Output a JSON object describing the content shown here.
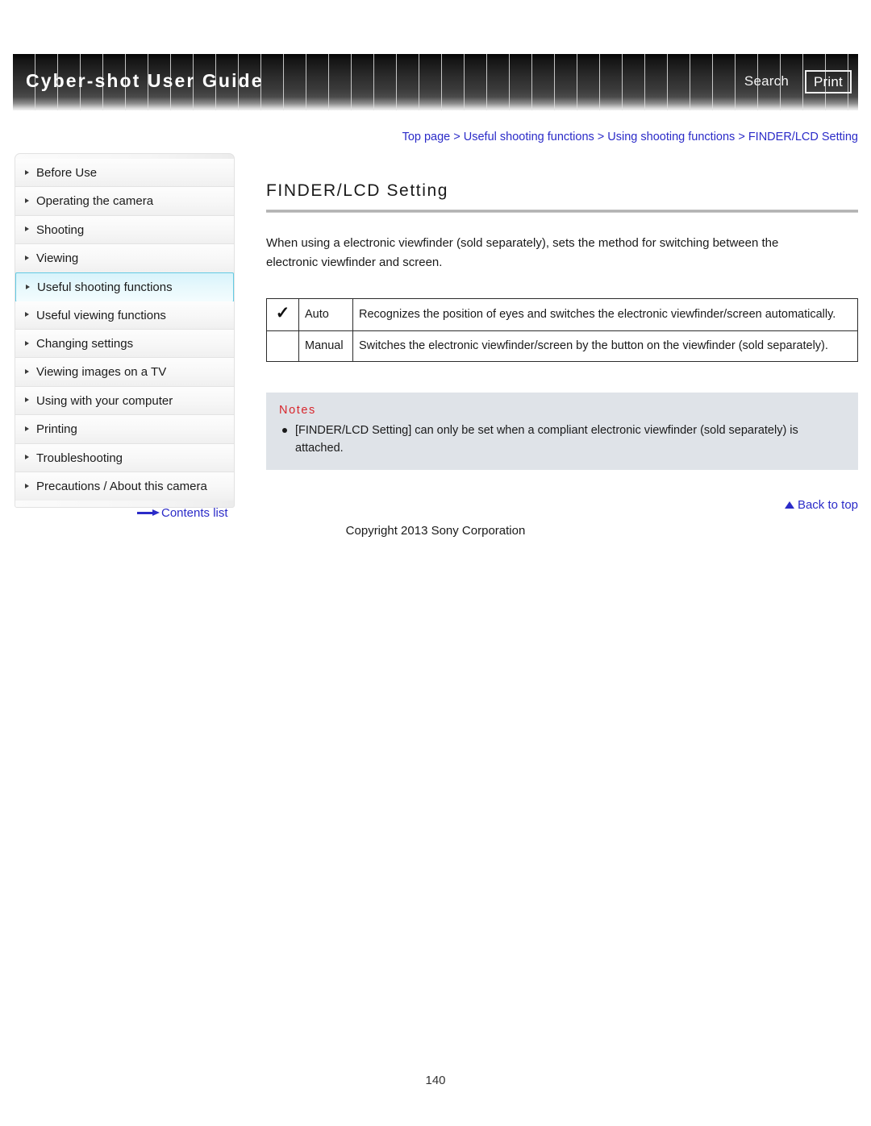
{
  "header": {
    "title": "Cyber-shot User Guide",
    "search_label": "Search",
    "print_label": "Print"
  },
  "breadcrumb": {
    "full": "Top page > Useful shooting functions > Using shooting functions > FINDER/LCD Setting",
    "items": [
      "Top page",
      "Useful shooting functions",
      "Using shooting functions",
      "FINDER/LCD Setting"
    ]
  },
  "sidebar": {
    "items": [
      {
        "label": "Before Use",
        "active": false
      },
      {
        "label": "Operating the camera",
        "active": false
      },
      {
        "label": "Shooting",
        "active": false
      },
      {
        "label": "Viewing",
        "active": false
      },
      {
        "label": "Useful shooting functions",
        "active": true
      },
      {
        "label": "Useful viewing functions",
        "active": false
      },
      {
        "label": "Changing settings",
        "active": false
      },
      {
        "label": "Viewing images on a TV",
        "active": false
      },
      {
        "label": "Using with your computer",
        "active": false
      },
      {
        "label": "Printing",
        "active": false
      },
      {
        "label": "Troubleshooting",
        "active": false
      },
      {
        "label": "Precautions / About this camera",
        "active": false
      }
    ],
    "contents_link": "Contents list"
  },
  "main": {
    "title": "FINDER/LCD Setting",
    "intro": "When using a electronic viewfinder (sold separately), sets the method for switching between the electronic viewfinder and screen.",
    "options": [
      {
        "checked": true,
        "check_icon": "checkmark-icon",
        "label": "Auto",
        "description": "Recognizes the position of eyes and switches the electronic viewfinder/screen automatically."
      },
      {
        "checked": false,
        "check_icon": "",
        "label": "Manual",
        "description": "Switches the electronic viewfinder/screen by the button on the viewfinder (sold separately)."
      }
    ],
    "notes": {
      "title": "Notes",
      "items": [
        "[FINDER/LCD Setting] can only be set when a compliant electronic viewfinder (sold separately) is attached."
      ]
    },
    "back_to_top": "Back to top"
  },
  "footer": {
    "copyright": "Copyright 2013 Sony Corporation",
    "page_number": "140"
  },
  "colors": {
    "link": "#2b2bc8",
    "notes_title": "#d8262c",
    "notes_bg": "#dfe3e8",
    "active_nav": "#63cbe4"
  }
}
